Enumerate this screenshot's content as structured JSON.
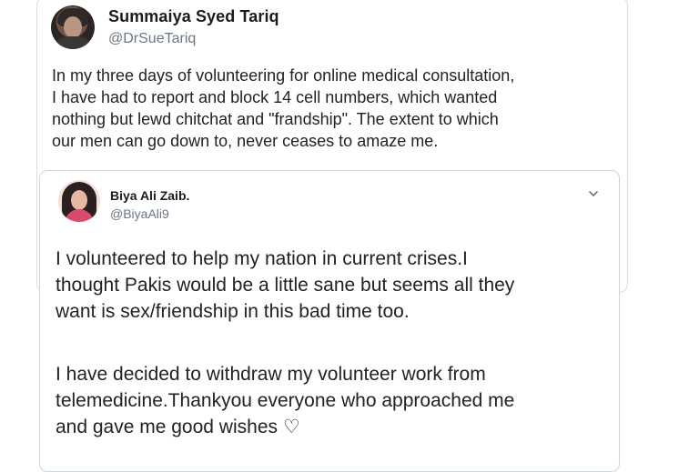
{
  "tweet": {
    "author_name": "Summaiya Syed Tariq",
    "author_handle": "@DrSueTariq",
    "text": "In my three days of volunteering for online medical consultation,\nI have had to report and block 14 cell numbers, which wanted\nnothing but lewd chitchat and \"frandship\". The extent to which\nour men can go down to, never ceases to amaze me."
  },
  "quoted_tweet": {
    "author_name": "Biya Ali Zaib.",
    "author_handle": "@BiyaAli9",
    "paragraph_1": "I volunteered to help my nation in current crises.I\nthought Pakis would be a little sane but seems all they\nwant is sex/friendship in this bad time too.",
    "paragraph_2": "I have decided to withdraw my volunteer work from\ntelemedicine.Thankyou everyone who approached me\nand gave me good wishes ♡"
  },
  "icons": {
    "menu": "chevron-down-icon"
  },
  "colors": {
    "handle": "#6b7682",
    "border": "#d0d4d8"
  }
}
